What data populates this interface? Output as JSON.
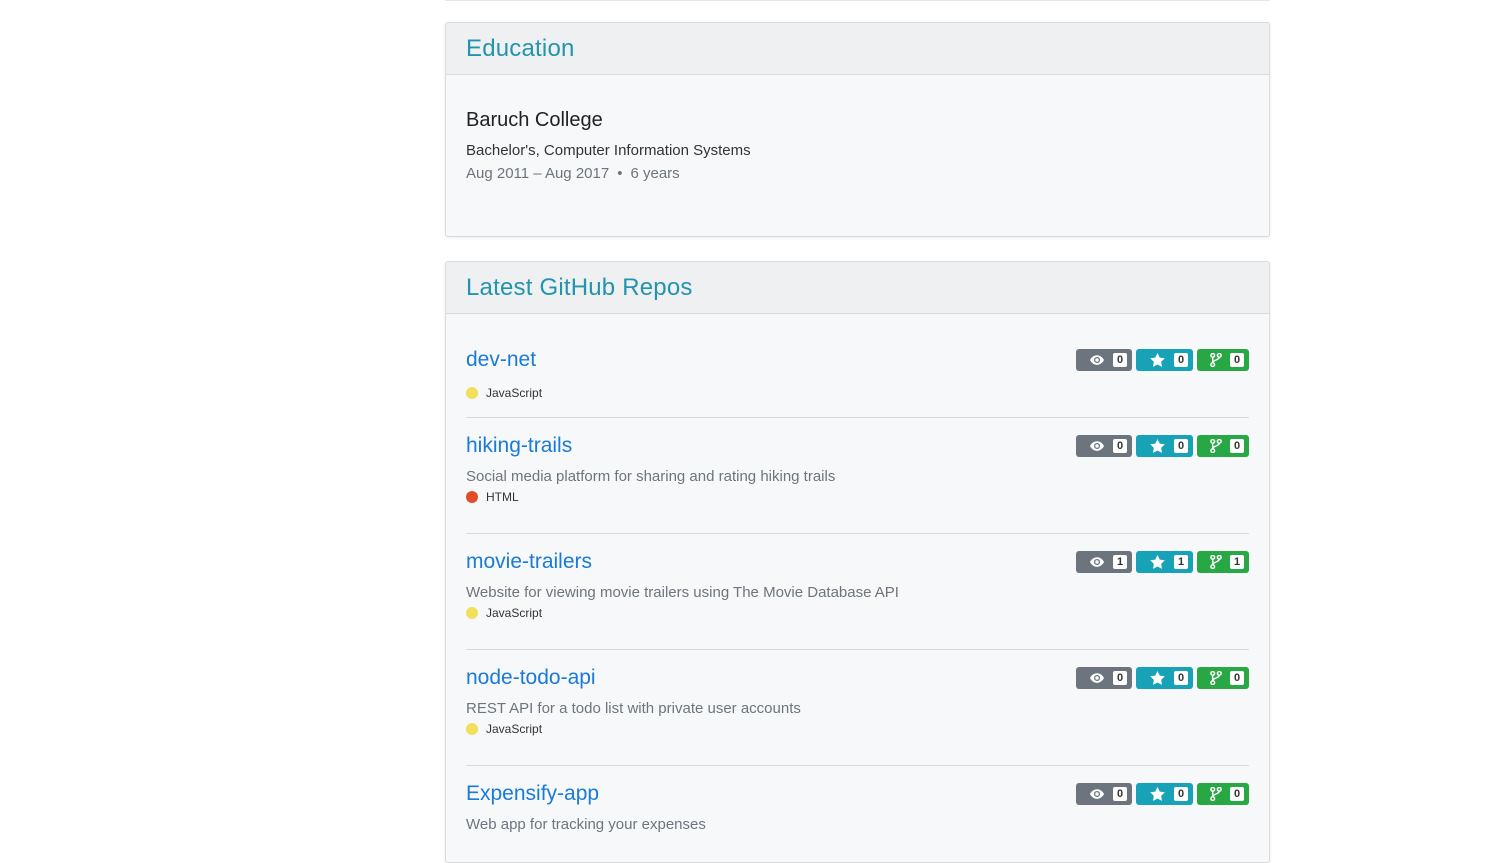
{
  "education": {
    "title": "Education",
    "school": "Baruch College",
    "degree": "Bachelor's, Computer Information Systems",
    "date_range": "Aug 2011 – Aug 2017",
    "separator": "•",
    "duration": "6 years"
  },
  "repos_section": {
    "title": "Latest GitHub Repos",
    "repos": [
      {
        "name": "dev-net",
        "description": "",
        "language": "JavaScript",
        "language_color": "#f1e05a",
        "watchers": "0",
        "stars": "0",
        "forks": "0"
      },
      {
        "name": "hiking-trails",
        "description": "Social media platform for sharing and rating hiking trails",
        "language": "HTML",
        "language_color": "#e34c26",
        "watchers": "0",
        "stars": "0",
        "forks": "0"
      },
      {
        "name": "movie-trailers",
        "description": "Website for viewing movie trailers using The Movie Database API",
        "language": "JavaScript",
        "language_color": "#f1e05a",
        "watchers": "1",
        "stars": "1",
        "forks": "1"
      },
      {
        "name": "node-todo-api",
        "description": "REST API for a todo list with private user accounts",
        "language": "JavaScript",
        "language_color": "#f1e05a",
        "watchers": "0",
        "stars": "0",
        "forks": "0"
      },
      {
        "name": "Expensify-app",
        "description": "Web app for tracking your expenses",
        "language": "",
        "language_color": "",
        "watchers": "0",
        "stars": "0",
        "forks": "0"
      }
    ]
  },
  "colors": {
    "accent_title": "#2394ad",
    "link": "#1a7ad8",
    "badge_watch": "#6c757d",
    "badge_star": "#17a2b8",
    "badge_fork": "#28a745"
  },
  "icons": {
    "watchers": "eye-icon",
    "stars": "star-icon",
    "forks": "fork-icon"
  }
}
